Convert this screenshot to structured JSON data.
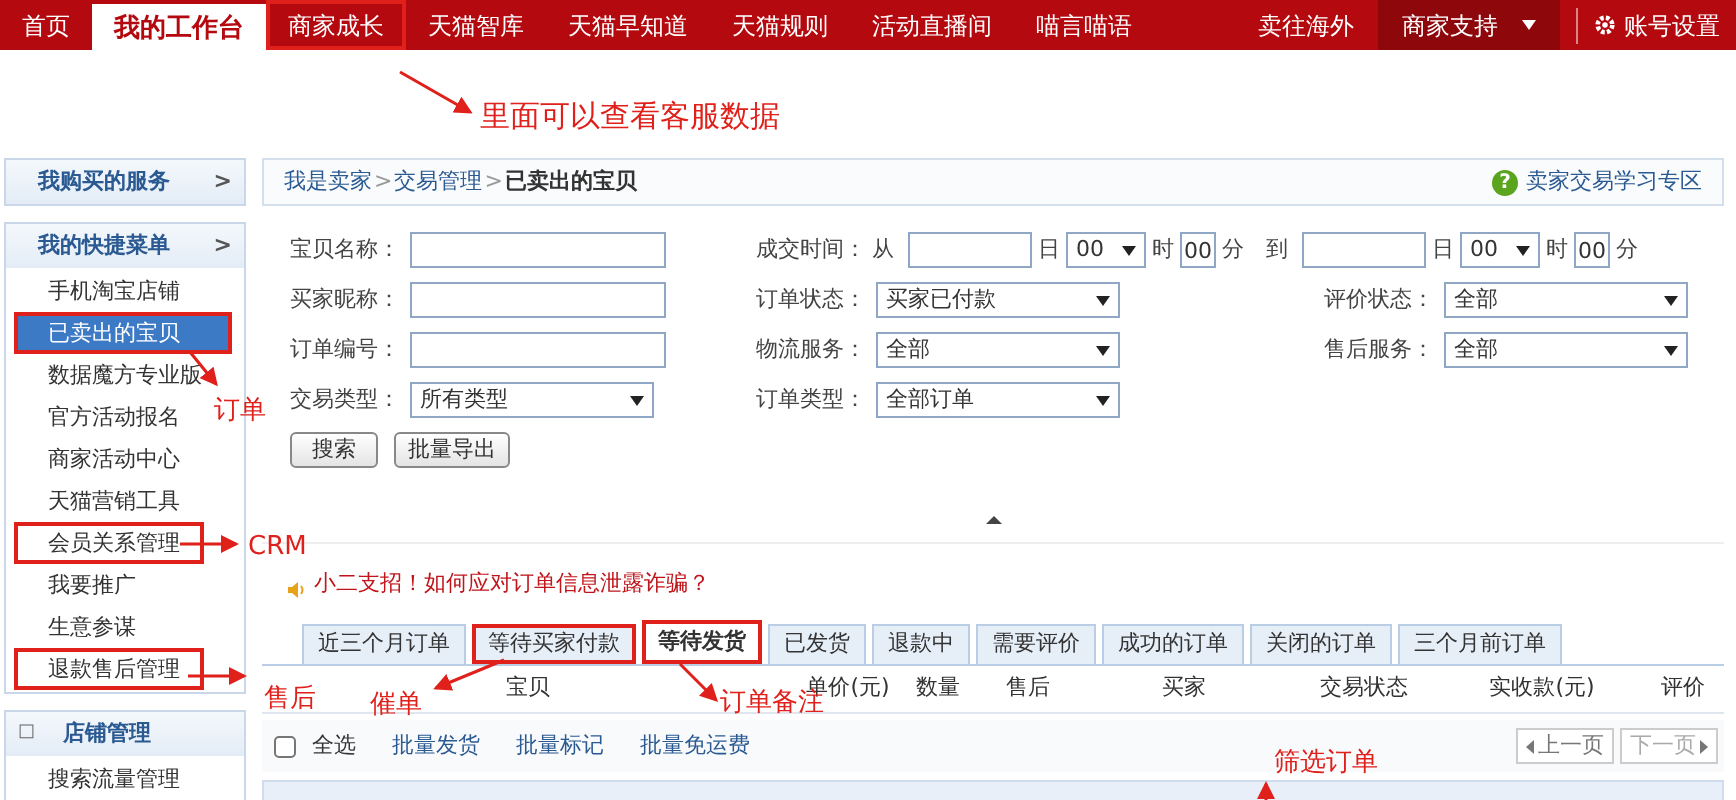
{
  "nav": {
    "items": [
      {
        "label": "首页",
        "selected": false,
        "highlighted": false
      },
      {
        "label": "我的工作台",
        "selected": true,
        "highlighted": false
      },
      {
        "label": "商家成长",
        "selected": false,
        "highlighted": true
      },
      {
        "label": "天猫智库",
        "selected": false,
        "highlighted": false
      },
      {
        "label": "天猫早知道",
        "selected": false,
        "highlighted": false
      },
      {
        "label": "天猫规则",
        "selected": false,
        "highlighted": false
      },
      {
        "label": "活动直播间",
        "selected": false,
        "highlighted": false
      },
      {
        "label": "喵言喵语",
        "selected": false,
        "highlighted": false
      }
    ],
    "sell_abroad": "卖往海外",
    "support": "商家支持",
    "account": "账号设置"
  },
  "sidebar": [
    {
      "title": "我购买的服务",
      "arrow": ">"
    },
    {
      "title": "我的快捷菜单",
      "arrow": ">",
      "items": [
        {
          "label": "手机淘宝店铺",
          "selected": false,
          "highlighted": false
        },
        {
          "label": "已卖出的宝贝",
          "selected": true,
          "highlighted": true
        },
        {
          "label": "数据魔方专业版",
          "selected": false,
          "highlighted": false
        },
        {
          "label": "官方活动报名",
          "selected": false,
          "highlighted": false
        },
        {
          "label": "商家活动中心",
          "selected": false,
          "highlighted": false
        },
        {
          "label": "天猫营销工具",
          "selected": false,
          "highlighted": false
        },
        {
          "label": "会员关系管理",
          "selected": false,
          "highlighted": true
        },
        {
          "label": "我要推广",
          "selected": false,
          "highlighted": false
        },
        {
          "label": "生意参谋",
          "selected": false,
          "highlighted": false
        },
        {
          "label": "退款售后管理",
          "selected": false,
          "highlighted": true
        }
      ]
    },
    {
      "title": "店铺管理",
      "toggle": "□",
      "items": [
        {
          "label": "搜索流量管理",
          "selected": false,
          "highlighted": false
        }
      ]
    }
  ],
  "breadcrumb": [
    {
      "label": "我是卖家",
      "current": false
    },
    {
      "label": "交易管理",
      "current": false
    },
    {
      "label": "已卖出的宝贝",
      "current": true
    }
  ],
  "help_icon": "?",
  "help_link": "卖家交易学习专区",
  "form": {
    "item_name": "宝贝名称：",
    "buyer_nick": "买家昵称：",
    "order_no": "订单编号：",
    "trade_type": {
      "label": "交易类型：",
      "value": "所有类型"
    },
    "deal_time": {
      "label": "成交时间：",
      "ranges": [
        {
          "prefix": "从",
          "day": "日",
          "hour_value": "00",
          "hour": "时",
          "minute_value": "00",
          "minute": "分"
        },
        {
          "prefix": "到",
          "day": "日",
          "hour_value": "00",
          "hour": "时",
          "minute_value": "00",
          "minute": "分"
        }
      ]
    },
    "order_status": {
      "label": "订单状态：",
      "value": "买家已付款"
    },
    "logistics": {
      "label": "物流服务：",
      "value": "全部"
    },
    "order_type": {
      "label": "订单类型：",
      "value": "全部订单"
    },
    "review_status": {
      "label": "评价状态：",
      "value": "全部"
    },
    "after_sale": {
      "label": "售后服务：",
      "value": "全部"
    },
    "buttons": [
      "搜索",
      "批量导出"
    ]
  },
  "notice": "小二支招！如何应对订单信息泄露诈骗？",
  "tabs": [
    {
      "label": "近三个月订单",
      "selected": false,
      "highlighted": false
    },
    {
      "label": "等待买家付款",
      "selected": false,
      "highlighted": true
    },
    {
      "label": "等待发货",
      "selected": true,
      "highlighted": true
    },
    {
      "label": "已发货",
      "selected": false,
      "highlighted": false
    },
    {
      "label": "退款中",
      "selected": false,
      "highlighted": false
    },
    {
      "label": "需要评价",
      "selected": false,
      "highlighted": false
    },
    {
      "label": "成功的订单",
      "selected": false,
      "highlighted": false
    },
    {
      "label": "关闭的订单",
      "selected": false,
      "highlighted": false
    },
    {
      "label": "三个月前订单",
      "selected": false,
      "highlighted": false
    }
  ],
  "table": {
    "columns": [
      "宝贝",
      "单价(元)",
      "数量",
      "售后",
      "买家",
      "交易状态",
      "实收款(元)",
      "评价"
    ]
  },
  "bulk": {
    "select_all": {
      "label": "全选",
      "checked": false
    },
    "actions": [
      "批量发货",
      "批量标记",
      "批量免运费"
    ],
    "prev": "上一页",
    "next": "下一页"
  },
  "annotations": [
    {
      "text": "里面可以查看客服数据"
    },
    {
      "text": "订单"
    },
    {
      "text": "CRM"
    },
    {
      "text": "售后"
    },
    {
      "text": "催单"
    },
    {
      "text": "订单备注"
    },
    {
      "text": "筛选订单"
    }
  ]
}
